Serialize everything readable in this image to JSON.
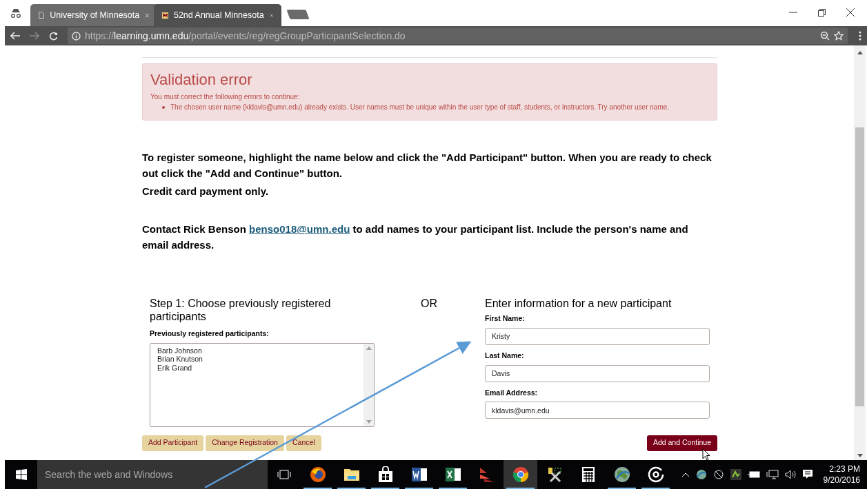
{
  "browser": {
    "tabs": [
      {
        "title": "University of Minnesota",
        "selected": false
      },
      {
        "title": "52nd Annual Minnesota",
        "selected": true
      }
    ],
    "url": {
      "scheme": "https://",
      "host": "learning.umn.edu",
      "path": "/portal/events/reg/regGroupParticipantSelection.do"
    }
  },
  "page": {
    "alert": {
      "title": "Validation error",
      "intro": "You must correct the following errors to continue:",
      "items": [
        "The chosen user name (kldavis@umn.edu) already exists. User names must be unique within the user type of staff, students, or instructors. Try another user name."
      ]
    },
    "instructions": [
      "To register someone, highlight the name below and click the \"Add Participant\" button. When you are ready to check out click the \"Add and Continue\" button.",
      "Credit card payment only."
    ],
    "contact": {
      "before": "Contact Rick Benson ",
      "link": "benso018@umn.edu",
      "after": " to add names to your participant list. Include the person's name and email address."
    },
    "step1": {
      "title": "Step 1: Choose previously registered participants",
      "list_label": "Previously registered participants:",
      "participants": [
        {
          "name": "Barb Johnson",
          "selected": false
        },
        {
          "name": "Brian Knutson",
          "selected": false
        },
        {
          "name": "Erik Grand",
          "selected": false
        }
      ]
    },
    "or_label": "OR",
    "new_participant": {
      "title": "Enter information for a new participant",
      "fields": [
        {
          "label": "First Name:",
          "value": "Kristy"
        },
        {
          "label": "Last Name:",
          "value": "Davis"
        },
        {
          "label": "Email Address:",
          "value": "kldavis@umn.edu"
        }
      ]
    },
    "buttons": [
      {
        "label": "Add Participant",
        "kind": "secondary"
      },
      {
        "label": "Change Registration",
        "kind": "secondary"
      },
      {
        "label": "Cancel",
        "kind": "secondary"
      },
      {
        "label": "Add and Continue",
        "kind": "primary"
      }
    ]
  },
  "taskbar": {
    "search_placeholder": "Search the web and Windows",
    "apps": [
      {
        "kind": "firefox",
        "running": true,
        "selected": false
      },
      {
        "kind": "explorer",
        "running": true,
        "selected": false
      },
      {
        "kind": "store",
        "running": true,
        "selected": false
      },
      {
        "kind": "word",
        "running": true,
        "selected": false
      },
      {
        "kind": "excel",
        "running": true,
        "selected": false
      },
      {
        "kind": "red-app",
        "running": false,
        "selected": false
      },
      {
        "kind": "chrome",
        "running": true,
        "selected": true
      },
      {
        "kind": "tools",
        "running": false,
        "selected": false
      },
      {
        "kind": "calculator",
        "running": false,
        "selected": false
      },
      {
        "kind": "globe",
        "running": true,
        "selected": false
      },
      {
        "kind": "music",
        "running": true,
        "selected": false
      }
    ],
    "time": "2:23 PM",
    "date": "9/20/2016"
  }
}
